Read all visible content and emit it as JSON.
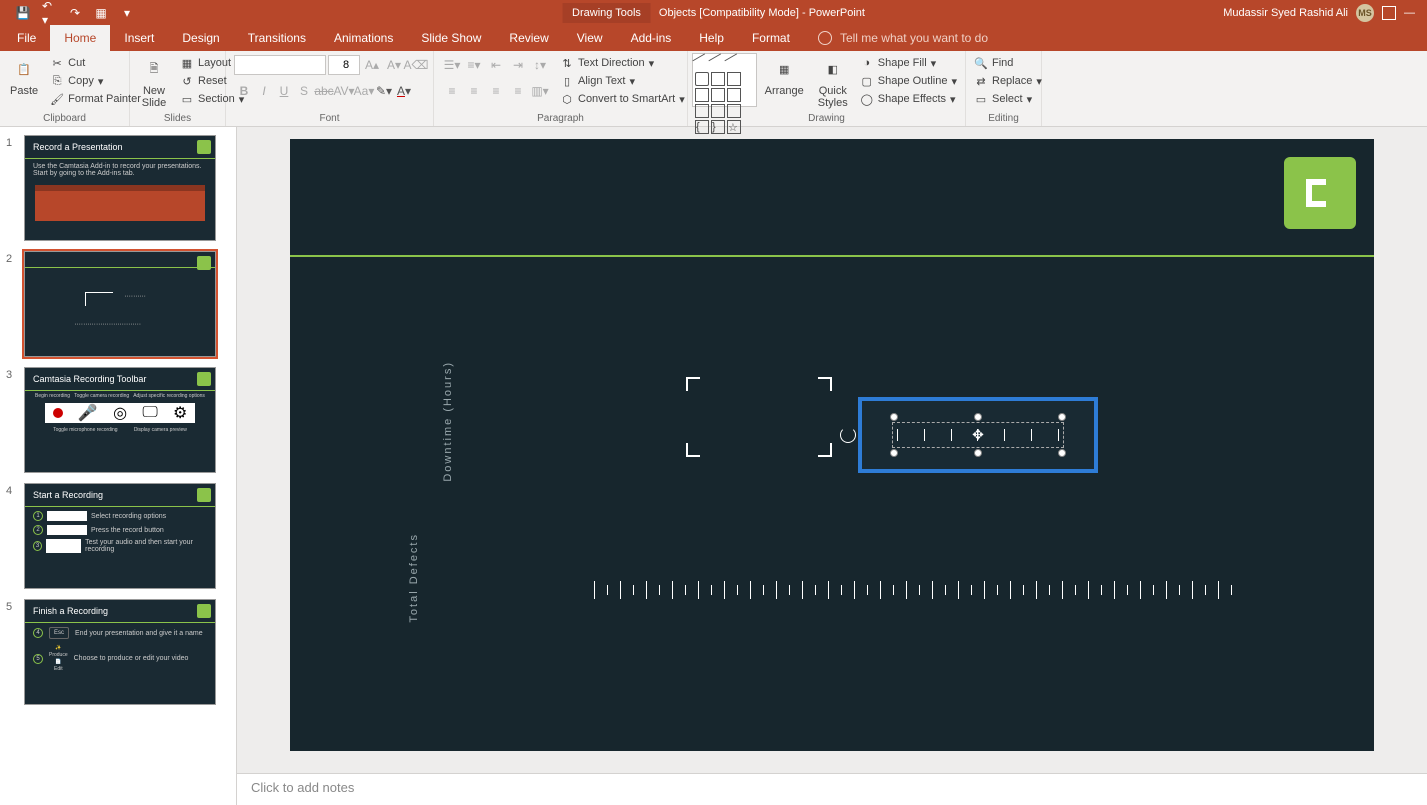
{
  "titlebar": {
    "drawing_tools": "Drawing Tools",
    "doc_title": "Objects [Compatibility Mode]  -  PowerPoint",
    "user": "Mudassir Syed Rashid Ali",
    "initials": "MS"
  },
  "tabs": {
    "file": "File",
    "home": "Home",
    "insert": "Insert",
    "design": "Design",
    "transitions": "Transitions",
    "animations": "Animations",
    "slideshow": "Slide Show",
    "review": "Review",
    "view": "View",
    "addins": "Add-ins",
    "help": "Help",
    "format": "Format",
    "tellme": "Tell me what you want to do"
  },
  "ribbon": {
    "clipboard": {
      "label": "Clipboard",
      "paste": "Paste",
      "cut": "Cut",
      "copy": "Copy",
      "fmt": "Format Painter"
    },
    "slides": {
      "label": "Slides",
      "new": "New\nSlide",
      "layout": "Layout",
      "reset": "Reset",
      "section": "Section"
    },
    "font": {
      "label": "Font",
      "size": "8"
    },
    "paragraph": {
      "label": "Paragraph",
      "textdir": "Text Direction",
      "align": "Align Text",
      "smart": "Convert to SmartArt"
    },
    "drawing": {
      "label": "Drawing",
      "arrange": "Arrange",
      "quick": "Quick\nStyles",
      "fill": "Shape Fill",
      "outline": "Shape Outline",
      "effects": "Shape Effects"
    },
    "editing": {
      "label": "Editing",
      "find": "Find",
      "replace": "Replace",
      "select": "Select"
    }
  },
  "thumbs": [
    {
      "n": "1",
      "title": "Record a Presentation",
      "body": "Use the Camtasia Add-in to record your presentations. Start by going to the Add-ins tab."
    },
    {
      "n": "2",
      "title": "",
      "body": ""
    },
    {
      "n": "3",
      "title": "Camtasia Recording Toolbar",
      "body": ""
    },
    {
      "n": "4",
      "title": "Start a Recording",
      "body": ""
    },
    {
      "n": "5",
      "title": "Finish a Recording",
      "body": ""
    }
  ],
  "thumb3": {
    "c1": "Begin recording",
    "c2": "Toggle camera recording",
    "c3": "Adjust specific recording options",
    "b1": "Toggle microphone recording",
    "b2": "Display camera preview"
  },
  "thumb4": {
    "s1": "Select recording options",
    "s2": "Press the record button",
    "s3": "Test your audio and then start your recording"
  },
  "thumb5": {
    "s1": "End your presentation and give it a name",
    "s2": "Choose to produce or edit your video",
    "produce": "Produce",
    "edit": "Edit"
  },
  "slide": {
    "vlabel1": "Downtime (Hours)",
    "vlabel2": "Total Defects"
  },
  "notes": {
    "placeholder": "Click to add notes"
  }
}
